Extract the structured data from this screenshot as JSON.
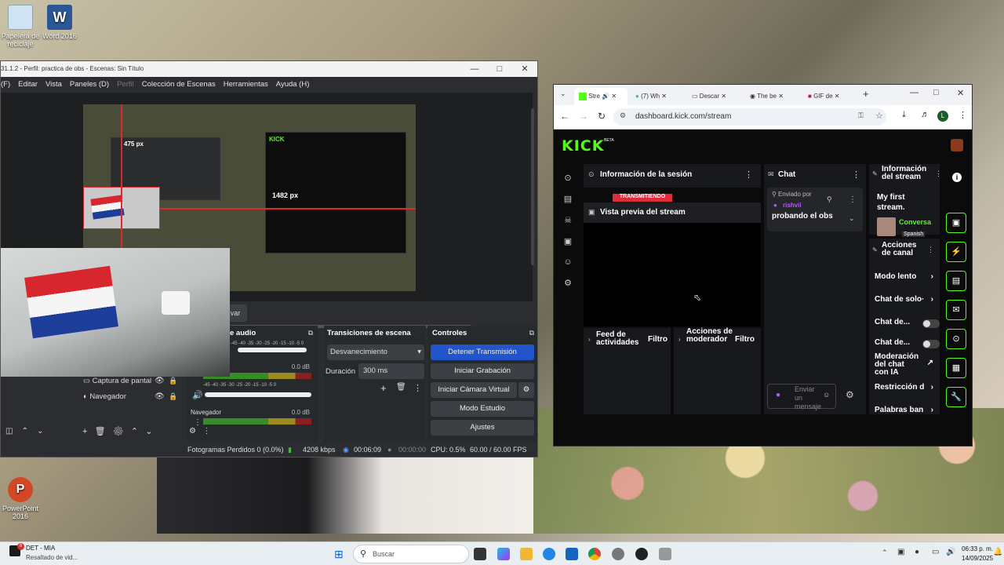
{
  "desktop": {
    "icons": [
      {
        "label": "Papelera de reciclaje"
      },
      {
        "label": "Word 2016"
      },
      {
        "label": "PowerPoint 2016"
      }
    ]
  },
  "obs": {
    "title": "31.1.2 - Perfil: practica de obs - Escenas: Sin Título",
    "menu": [
      "(F)",
      "Editar",
      "Vista",
      "Paneles (D)",
      "Perfil",
      "Colección de Escenas",
      "Herramientas",
      "Ayuda (H)"
    ],
    "preview_labels": {
      "size_a": "475 px",
      "size_b": "1482 px"
    },
    "studio_btn_partial": "var",
    "audio": {
      "header": "e audio",
      "ticks": "-45 -40 -35 -30 -25 -20 -15 -10 -5 0",
      "db1": "0.0 dB",
      "db2": "0.0 dB",
      "navegador_label": "Navegador"
    },
    "sources": [
      {
        "label": "Captura de pantal"
      },
      {
        "label": "Navegador"
      }
    ],
    "transitions": {
      "header": "Transiciones de escena",
      "selected": "Desvanecimiento",
      "duration_label": "Duración",
      "duration_value": "300 ms"
    },
    "controls": {
      "header": "Controles",
      "buttons": [
        "Detener Transmisión",
        "Iniciar Grabación",
        "Iniciar Cámara Virtual",
        "Modo Estudio",
        "Ajustes"
      ]
    },
    "status": {
      "dropped": "Fotogramas Perdidos 0 (0.0%)",
      "bitrate": "4208 kbps",
      "stream_time": "00:06:09",
      "rec_time": "00:00:00",
      "cpu": "CPU: 0.5%",
      "fps": "60.00 / 60.00 FPS"
    }
  },
  "chrome": {
    "tabs": [
      {
        "label": "Stre"
      },
      {
        "label": "(7) Wh"
      },
      {
        "label": "Descar"
      },
      {
        "label": "The be"
      },
      {
        "label": "GIF de"
      }
    ],
    "url": "dashboard.kick.com/stream"
  },
  "kick": {
    "logo": "KICK",
    "logo_badge": "BETA",
    "session_title": "Información de la sesión",
    "live_badge": "TRANSMITIENDO",
    "preview_title": "Vista previa del stream",
    "chat_title": "Chat",
    "pinned_by": "Enviado por",
    "pinned_user": "rishvii",
    "pinned_msg": "probando el obs",
    "chat_placeholder": "Enviar un mensaje",
    "feed_title": "Feed de actividades",
    "feed_filter": "Filtro",
    "mod_title": "Acciones de moderador",
    "mod_filter": "Filtro",
    "info_title": "Información del stream",
    "stream_name": "My first stream.",
    "category": "Conversa",
    "language": "Spanish",
    "channel_actions": "Acciones de canal",
    "actions": [
      {
        "label": "Modo lento",
        "type": "chevron"
      },
      {
        "label": "Chat de solo·",
        "type": "chevron"
      },
      {
        "label": "Chat de...",
        "type": "toggle"
      },
      {
        "label": "Chat de...",
        "type": "toggle"
      },
      {
        "label": "Moderación del chat con IA",
        "type": "external"
      },
      {
        "label": "Restricción d",
        "type": "chevron"
      },
      {
        "label": "Palabras ban",
        "type": "chevron"
      }
    ]
  },
  "taskbar": {
    "notif_app": "DET - MIA",
    "notif_sub": "Resaltado de vid...",
    "notif_count": "8",
    "search_placeholder": "Buscar",
    "time": "06:33 p. m.",
    "date": "14/09/2025"
  }
}
